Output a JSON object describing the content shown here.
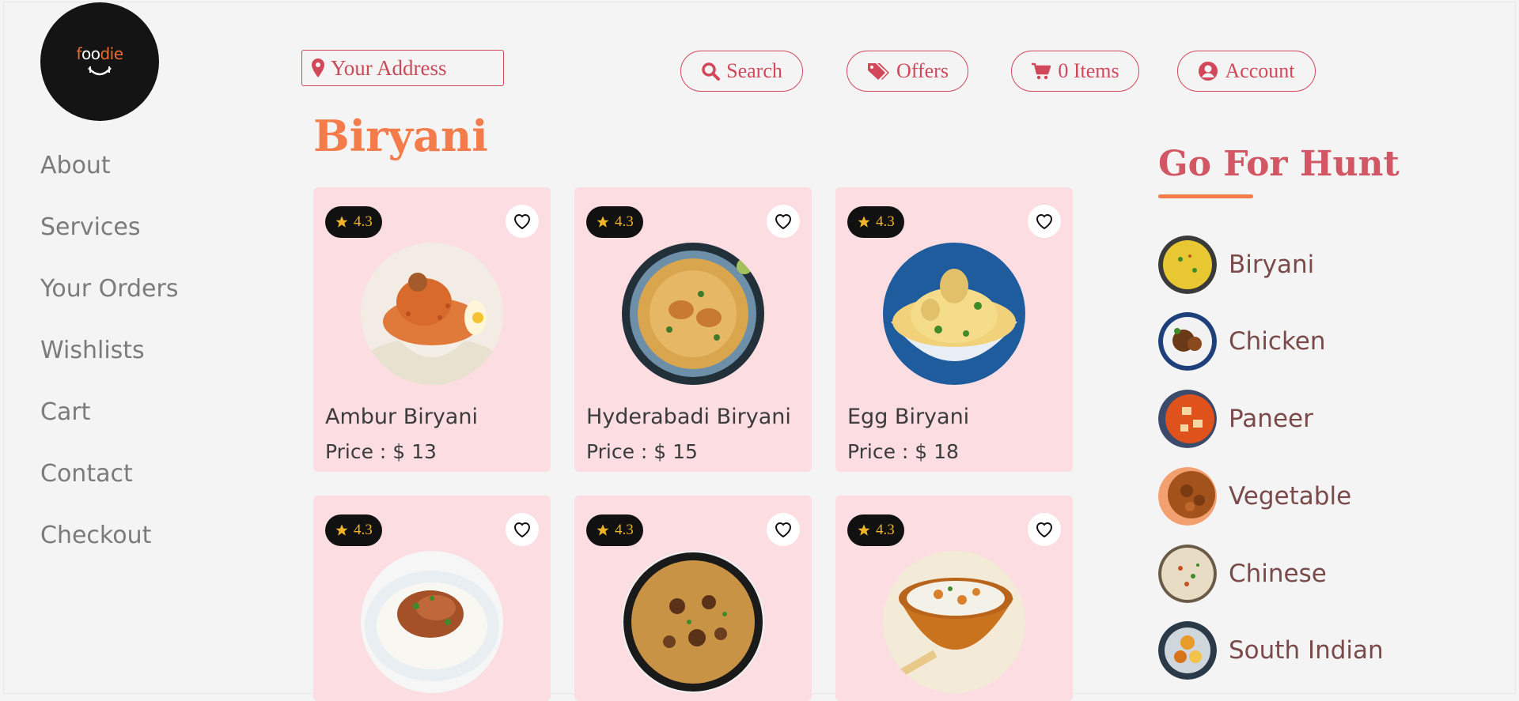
{
  "brand": {
    "logo_prefix": "f",
    "logo_oo": "oo",
    "logo_suffix": "die",
    "accent": "#d0485a",
    "orange": "#f47c4a"
  },
  "sidebar": {
    "items": [
      {
        "label": "About"
      },
      {
        "label": "Services"
      },
      {
        "label": "Your Orders"
      },
      {
        "label": "Wishlists"
      },
      {
        "label": "Cart"
      },
      {
        "label": "Contact"
      },
      {
        "label": "Checkout"
      }
    ]
  },
  "header": {
    "address_placeholder": "Your Address",
    "search_label": "Search",
    "offers_label": "Offers",
    "cart_label": "0 Items",
    "account_label": "Account"
  },
  "main": {
    "title": "Biryani",
    "cards": [
      {
        "rating": "4.3",
        "name": "Ambur Biryani",
        "price": "Price : $ 13"
      },
      {
        "rating": "4.3",
        "name": "Hyderabadi Biryani",
        "price": "Price : $ 15"
      },
      {
        "rating": "4.3",
        "name": "Egg Biryani",
        "price": "Price : $ 18"
      },
      {
        "rating": "4.3"
      },
      {
        "rating": "4.3"
      },
      {
        "rating": "4.3"
      }
    ]
  },
  "categories": {
    "title": "Go For Hunt",
    "items": [
      {
        "label": "Biryani"
      },
      {
        "label": "Chicken"
      },
      {
        "label": "Paneer"
      },
      {
        "label": "Vegetable"
      },
      {
        "label": "Chinese"
      },
      {
        "label": "South Indian"
      }
    ]
  }
}
